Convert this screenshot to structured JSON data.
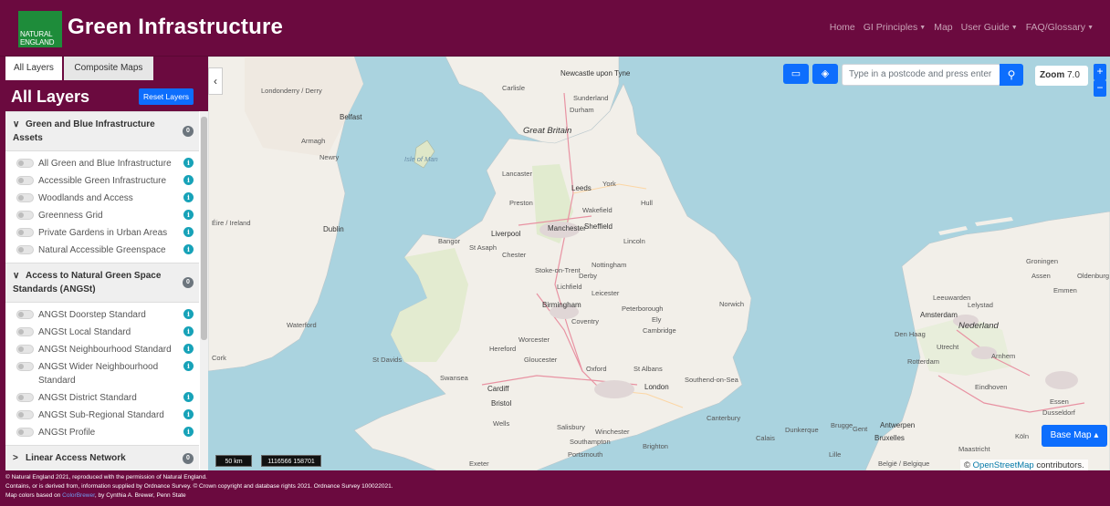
{
  "header": {
    "logo_line1": "NATURAL",
    "logo_line2": "ENGLAND",
    "title": "Green Infrastructure",
    "nav": [
      {
        "label": "Home",
        "dropdown": false
      },
      {
        "label": "GI Principles",
        "dropdown": true
      },
      {
        "label": "Map",
        "dropdown": false
      },
      {
        "label": "User Guide",
        "dropdown": true
      },
      {
        "label": "FAQ/Glossary",
        "dropdown": true
      }
    ]
  },
  "sidebar": {
    "tabs": [
      "All Layers",
      "Composite Maps"
    ],
    "title": "All Layers",
    "reset_label": "Reset Layers",
    "sections": [
      {
        "title": "Green and Blue Infrastructure Assets",
        "count": "0",
        "expanded": true,
        "layers": [
          "All Green and Blue Infrastructure",
          "Accessible Green Infrastructure",
          "Woodlands and Access",
          "Greenness Grid",
          "Private Gardens in Urban Areas",
          "Natural Accessible Greenspace"
        ]
      },
      {
        "title": "Access to Natural Green Space Standards (ANGSt)",
        "count": "0",
        "expanded": true,
        "layers": [
          "ANGSt Doorstep Standard",
          "ANGSt Local Standard",
          "ANGSt Neighbourhood Standard",
          "ANGSt Wider Neighbourhood Standard",
          "ANGSt District Standard",
          "ANGSt Sub-Regional Standard",
          "ANGSt Profile"
        ]
      },
      {
        "title": "Linear Access Network",
        "count": "0",
        "expanded": false,
        "layers": []
      }
    ]
  },
  "map": {
    "search_placeholder": "Type in a postcode and press enter",
    "zoom_label": "Zoom",
    "zoom_value": "7.0",
    "zoom_in": "+",
    "zoom_out": "−",
    "basemap_label": "Base Map",
    "attribution_prefix": "©",
    "attribution_link": "OpenStreetMap",
    "attribution_suffix": "contributors.",
    "scale_label": "50 km",
    "coords": "1116566 158701",
    "labels": {
      "great_britain": "Great Britain",
      "isle_of_man": "Isle of Man",
      "eire": "Éire / Ireland",
      "newcastle": "Newcastle upon Tyne",
      "carlisle": "Carlisle",
      "sunderland": "Sunderland",
      "durham": "Durham",
      "londonderry": "Londonderry / Derry",
      "belfast": "Belfast",
      "armagh": "Armagh",
      "newry": "Newry",
      "lancaster": "Lancaster",
      "leeds": "Leeds",
      "york": "York",
      "preston": "Preston",
      "hull": "Hull",
      "wakefield": "Wakefield",
      "dublin": "Dublin",
      "manchester": "Manchester",
      "sheffield": "Sheffield",
      "liverpool": "Liverpool",
      "bangor": "Bangor",
      "st_asaph": "St Asaph",
      "chester": "Chester",
      "lincoln": "Lincoln",
      "stoke": "Stoke-on-Trent",
      "derby": "Derby",
      "nottingham": "Nottingham",
      "lichfield": "Lichfield",
      "leicester": "Leicester",
      "birmingham": "Birmingham",
      "peterborough": "Peterborough",
      "norwich": "Norwich",
      "ely": "Ely",
      "coventry": "Coventry",
      "cambridge": "Cambridge",
      "waterford": "Waterford",
      "worcester": "Worcester",
      "hereford": "Hereford",
      "gloucester": "Gloucester",
      "cork": "Cork",
      "st_davids": "St Davids",
      "oxford": "Oxford",
      "st_albans": "St Albans",
      "southend": "Southend-on-Sea",
      "swansea": "Swansea",
      "cardiff": "Cardiff",
      "london": "London",
      "bristol": "Bristol",
      "canterbury": "Canterbury",
      "wells": "Wells",
      "salisbury": "Salisbury",
      "winchester": "Winchester",
      "southampton": "Southampton",
      "brighton": "Brighton",
      "portsmouth": "Portsmouth",
      "exeter": "Exeter",
      "amsterdam": "Amsterdam",
      "nederland": "Nederland",
      "leeuwarden": "Leeuwarden",
      "groningen": "Groningen",
      "emmen": "Emmen",
      "assen": "Assen",
      "lelystad": "Lelystad",
      "utrecht": "Utrecht",
      "arnhem": "Arnhem",
      "rotterdam": "Rotterdam",
      "den_haag": "Den Haag",
      "antwerpen": "Antwerpen",
      "bruxelles": "Bruxelles",
      "brugge": "Brugge",
      "gent": "Gent",
      "dunkerque": "Dunkerque",
      "calais": "Calais",
      "belgie": "België / Belgique",
      "duisburg": "Dusseldorf",
      "koln": "Köln",
      "essen": "Essen",
      "maastricht": "Maastricht",
      "lille": "Lille",
      "eindhoven": "Eindhoven",
      "oldenburg": "Oldenburg"
    }
  },
  "footer": {
    "line1": "© Natural England 2021, reproduced with the permission of Natural England.",
    "line2": "Contains, or is derived from, information supplied by Ordnance Survey. © Crown copyright and database rights 2021. Ordnance Survey 100022021.",
    "line3_prefix": "Map colors based on",
    "line3_link": "ColorBrewer",
    "line3_suffix": ", by Cynthia A. Brewer, Penn State"
  },
  "colors": {
    "brand": "#6b0a3f",
    "accent": "#0d6efd",
    "info": "#17a2b8",
    "sea": "#aad3df",
    "land": "#f2efe9"
  }
}
